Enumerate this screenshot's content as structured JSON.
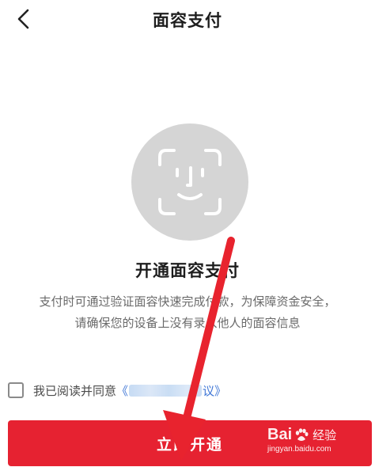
{
  "header": {
    "title": "面容支付",
    "back_icon": "chevron-left-icon"
  },
  "illustration": {
    "icon": "face-id-icon",
    "circle_color": "#d5d5d5"
  },
  "main": {
    "headline": "开通面容支付",
    "description_line1": "支付时可通过验证面容快速完成付款，为保障资金安全，",
    "description_line2": "请确保您的设备上没有录入他人的面容信息"
  },
  "agreement": {
    "text": "我已阅读并同意",
    "link_open": "《",
    "link_close": "议》"
  },
  "action": {
    "open_label": "立即开通",
    "color": "#e62231"
  },
  "watermark": {
    "brand_left": "Bai",
    "brand_right": "经验",
    "url": "jingyan.baidu.com"
  },
  "annotation": {
    "arrow_color": "#e8232e"
  }
}
